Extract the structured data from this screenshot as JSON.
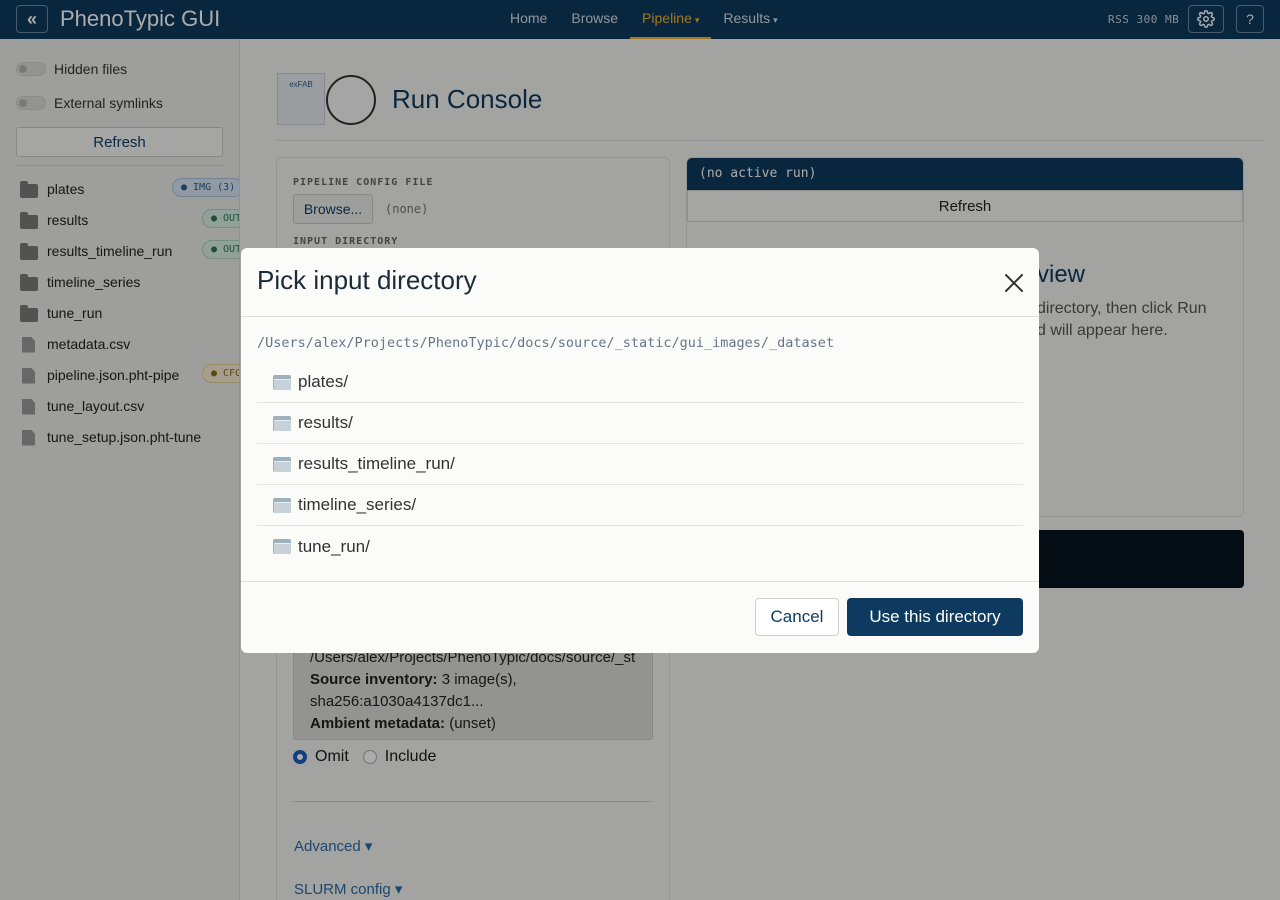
{
  "navbar": {
    "collapse_icon": "chevrons-left-icon",
    "brand": "PhenoTypic GUI",
    "links": [
      {
        "label": "Home",
        "active": false,
        "dropdown": false
      },
      {
        "label": "Browse",
        "active": false,
        "dropdown": false
      },
      {
        "label": "Pipeline",
        "active": true,
        "dropdown": true
      },
      {
        "label": "Results",
        "active": false,
        "dropdown": true
      }
    ],
    "rss": "RSS 300 MB",
    "help_label": "?",
    "accent_color": "#f1b42f",
    "bg_color": "#0e3a5f"
  },
  "sidebar": {
    "toggle_hidden": "Hidden files",
    "toggle_symlinks": "External symlinks",
    "refresh_label": "Refresh",
    "items": [
      {
        "name": "plates",
        "kind": "folder",
        "badge": "● IMG (3)",
        "badge_type": "img"
      },
      {
        "name": "results",
        "kind": "folder",
        "badge": "● OUT",
        "badge_type": "out"
      },
      {
        "name": "results_timeline_run",
        "kind": "folder",
        "badge": "● OUT",
        "badge_type": "out"
      },
      {
        "name": "timeline_series",
        "kind": "folder",
        "badge": "",
        "badge_type": ""
      },
      {
        "name": "tune_run",
        "kind": "folder",
        "badge": "",
        "badge_type": ""
      },
      {
        "name": "metadata.csv",
        "kind": "file",
        "badge": "",
        "badge_type": ""
      },
      {
        "name": "pipeline.json.pht-pipe",
        "kind": "file",
        "badge": "● CFG",
        "badge_type": "cfg"
      },
      {
        "name": "tune_layout.csv",
        "kind": "file",
        "badge": "",
        "badge_type": ""
      },
      {
        "name": "tune_setup.json.pht-tune",
        "kind": "file",
        "badge": "",
        "badge_type": ""
      }
    ]
  },
  "main": {
    "title": "Run Console",
    "logo1_text": "exFAB",
    "left_panel": {
      "config_label": "PIPELINE CONFIG FILE",
      "browse_label": "Browse...",
      "config_value": "(none)",
      "input_dir_label": "INPUT DIRECTORY",
      "info_path": "/Users/alex/Projects/PhenoTypic/docs/source/_static/gui_images/_dataset/plates",
      "source_label": "Source inventory:",
      "source_value": "3 image(s),",
      "sha_value": "sha256:a1030a4137dc1...",
      "ambient_label": "Ambient metadata:",
      "ambient_value": "(unset)",
      "radio_omit": "Omit",
      "radio_include": "Include",
      "advanced_link": "Advanced ▾",
      "slurm_link": "SLURM config ▾"
    },
    "right_panel": {
      "status": "(no active run)",
      "refresh_label": "Refresh",
      "overview_fragment": "view",
      "line1_fragment": "directory, then click Run",
      "line2_fragment": "d will appear here."
    }
  },
  "modal": {
    "title": "Pick input directory",
    "path": "/Users/alex/Projects/PhenoTypic/docs/source/_static/gui_images/_dataset",
    "directories": [
      "plates/",
      "results/",
      "results_timeline_run/",
      "timeline_series/",
      "tune_run/"
    ],
    "cancel_label": "Cancel",
    "confirm_label": "Use this directory"
  }
}
